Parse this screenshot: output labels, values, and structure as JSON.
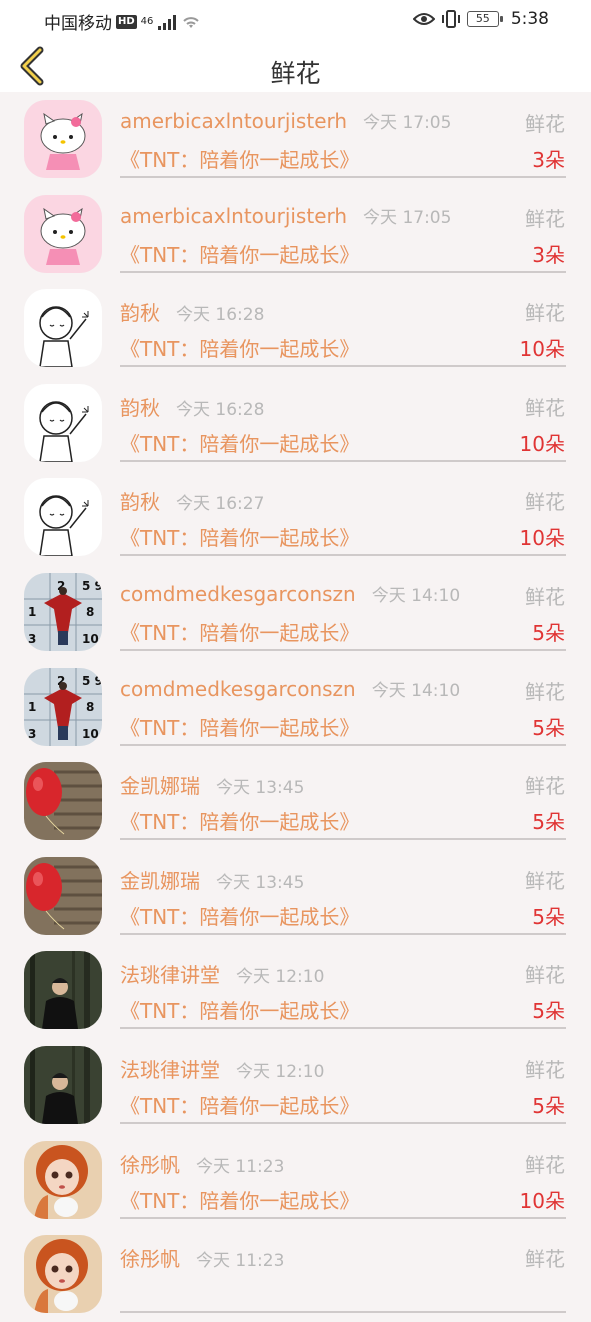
{
  "status_bar": {
    "carrier": "中国移动",
    "hd": "HD",
    "network": "46",
    "battery": "55",
    "time": "5:38"
  },
  "header": {
    "title": "鲜花"
  },
  "items": [
    {
      "name": "amerbicaxlntourjisterh",
      "time": "今天 17:05",
      "type": "鲜花",
      "book": "《TNT：陪着你一起成长》",
      "count": "3朵",
      "avatar": "hello-kitty"
    },
    {
      "name": "amerbicaxlntourjisterh",
      "time": "今天 17:05",
      "type": "鲜花",
      "book": "《TNT：陪着你一起成长》",
      "count": "3朵",
      "avatar": "hello-kitty"
    },
    {
      "name": "韵秋",
      "time": "今天 16:28",
      "type": "鲜花",
      "book": "《TNT：陪着你一起成长》",
      "count": "10朵",
      "avatar": "sketch-girl"
    },
    {
      "name": "韵秋",
      "time": "今天 16:28",
      "type": "鲜花",
      "book": "《TNT：陪着你一起成长》",
      "count": "10朵",
      "avatar": "sketch-girl"
    },
    {
      "name": "韵秋",
      "time": "今天 16:27",
      "type": "鲜花",
      "book": "《TNT：陪着你一起成长》",
      "count": "10朵",
      "avatar": "sketch-girl"
    },
    {
      "name": "comdmedkesgarconszn",
      "time": "今天 14:10",
      "type": "鲜花",
      "book": "《TNT：陪着你一起成长》",
      "count": "5朵",
      "avatar": "number-wall"
    },
    {
      "name": "comdmedkesgarconszn",
      "time": "今天 14:10",
      "type": "鲜花",
      "book": "《TNT：陪着你一起成长》",
      "count": "5朵",
      "avatar": "number-wall"
    },
    {
      "name": "金凯娜瑞",
      "time": "今天 13:45",
      "type": "鲜花",
      "book": "《TNT：陪着你一起成长》",
      "count": "5朵",
      "avatar": "red-balloon"
    },
    {
      "name": "金凯娜瑞",
      "time": "今天 13:45",
      "type": "鲜花",
      "book": "《TNT：陪着你一起成长》",
      "count": "5朵",
      "avatar": "red-balloon"
    },
    {
      "name": "法珧律讲堂",
      "time": "今天 12:10",
      "type": "鲜花",
      "book": "《TNT：陪着你一起成长》",
      "count": "5朵",
      "avatar": "forest-man"
    },
    {
      "name": "法珧律讲堂",
      "time": "今天 12:10",
      "type": "鲜花",
      "book": "《TNT：陪着你一起成长》",
      "count": "5朵",
      "avatar": "forest-man"
    },
    {
      "name": "徐彤帆",
      "time": "今天 11:23",
      "type": "鲜花",
      "book": "《TNT：陪着你一起成长》",
      "count": "10朵",
      "avatar": "doll"
    },
    {
      "name": "徐彤帆",
      "time": "今天 11:23",
      "type": "鲜花",
      "book": "",
      "count": "",
      "avatar": "doll"
    }
  ]
}
